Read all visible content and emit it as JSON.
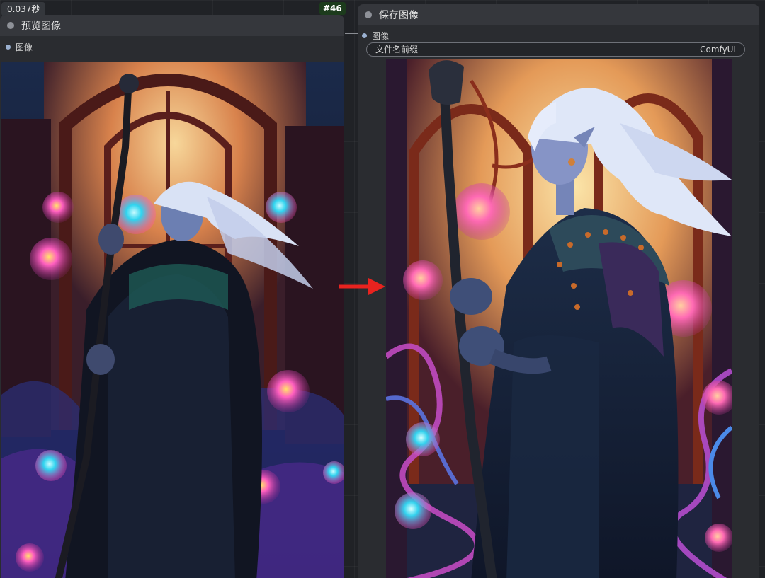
{
  "timing": "0.037秒",
  "node_id": "#46",
  "preview_node": {
    "title": "预览图像",
    "input_label": "图像"
  },
  "save_node": {
    "title": "保存图像",
    "input_label": "图像",
    "filename_prefix_label": "文件名前缀",
    "filename_prefix_value": "ComfyUI"
  },
  "colors": {
    "arrow": "#e8231f",
    "node_bg": "#2a2c30",
    "header_bg": "#35373c"
  }
}
